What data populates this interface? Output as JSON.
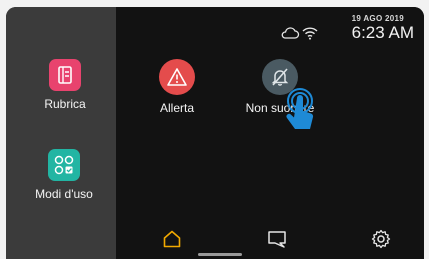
{
  "status": {
    "date": "19 AGO 2019",
    "time": "6:23 AM",
    "icons": [
      "cloud-icon",
      "wifi-icon"
    ]
  },
  "sidebar": {
    "items": [
      {
        "label": "Rubrica",
        "icon": "address-book-icon",
        "color": "#e8436e"
      },
      {
        "label": "Modi d'uso",
        "icon": "usage-modes-icon",
        "color": "#22b5a3"
      }
    ]
  },
  "main": {
    "tiles": [
      {
        "label": "Allerta",
        "icon": "alert-icon",
        "color": "#e44c4c"
      },
      {
        "label": "Non suonare",
        "icon": "bell-off-icon",
        "color": "#4a5a62"
      }
    ]
  },
  "nav": {
    "items": [
      {
        "name": "home",
        "icon": "home-icon",
        "active": true,
        "color": "#f2a900"
      },
      {
        "name": "messages",
        "icon": "chat-icon",
        "active": false
      },
      {
        "name": "settings",
        "icon": "gear-icon",
        "active": false
      }
    ]
  },
  "colors": {
    "accent": "#f2a900",
    "touch": "#1e8ad6"
  }
}
